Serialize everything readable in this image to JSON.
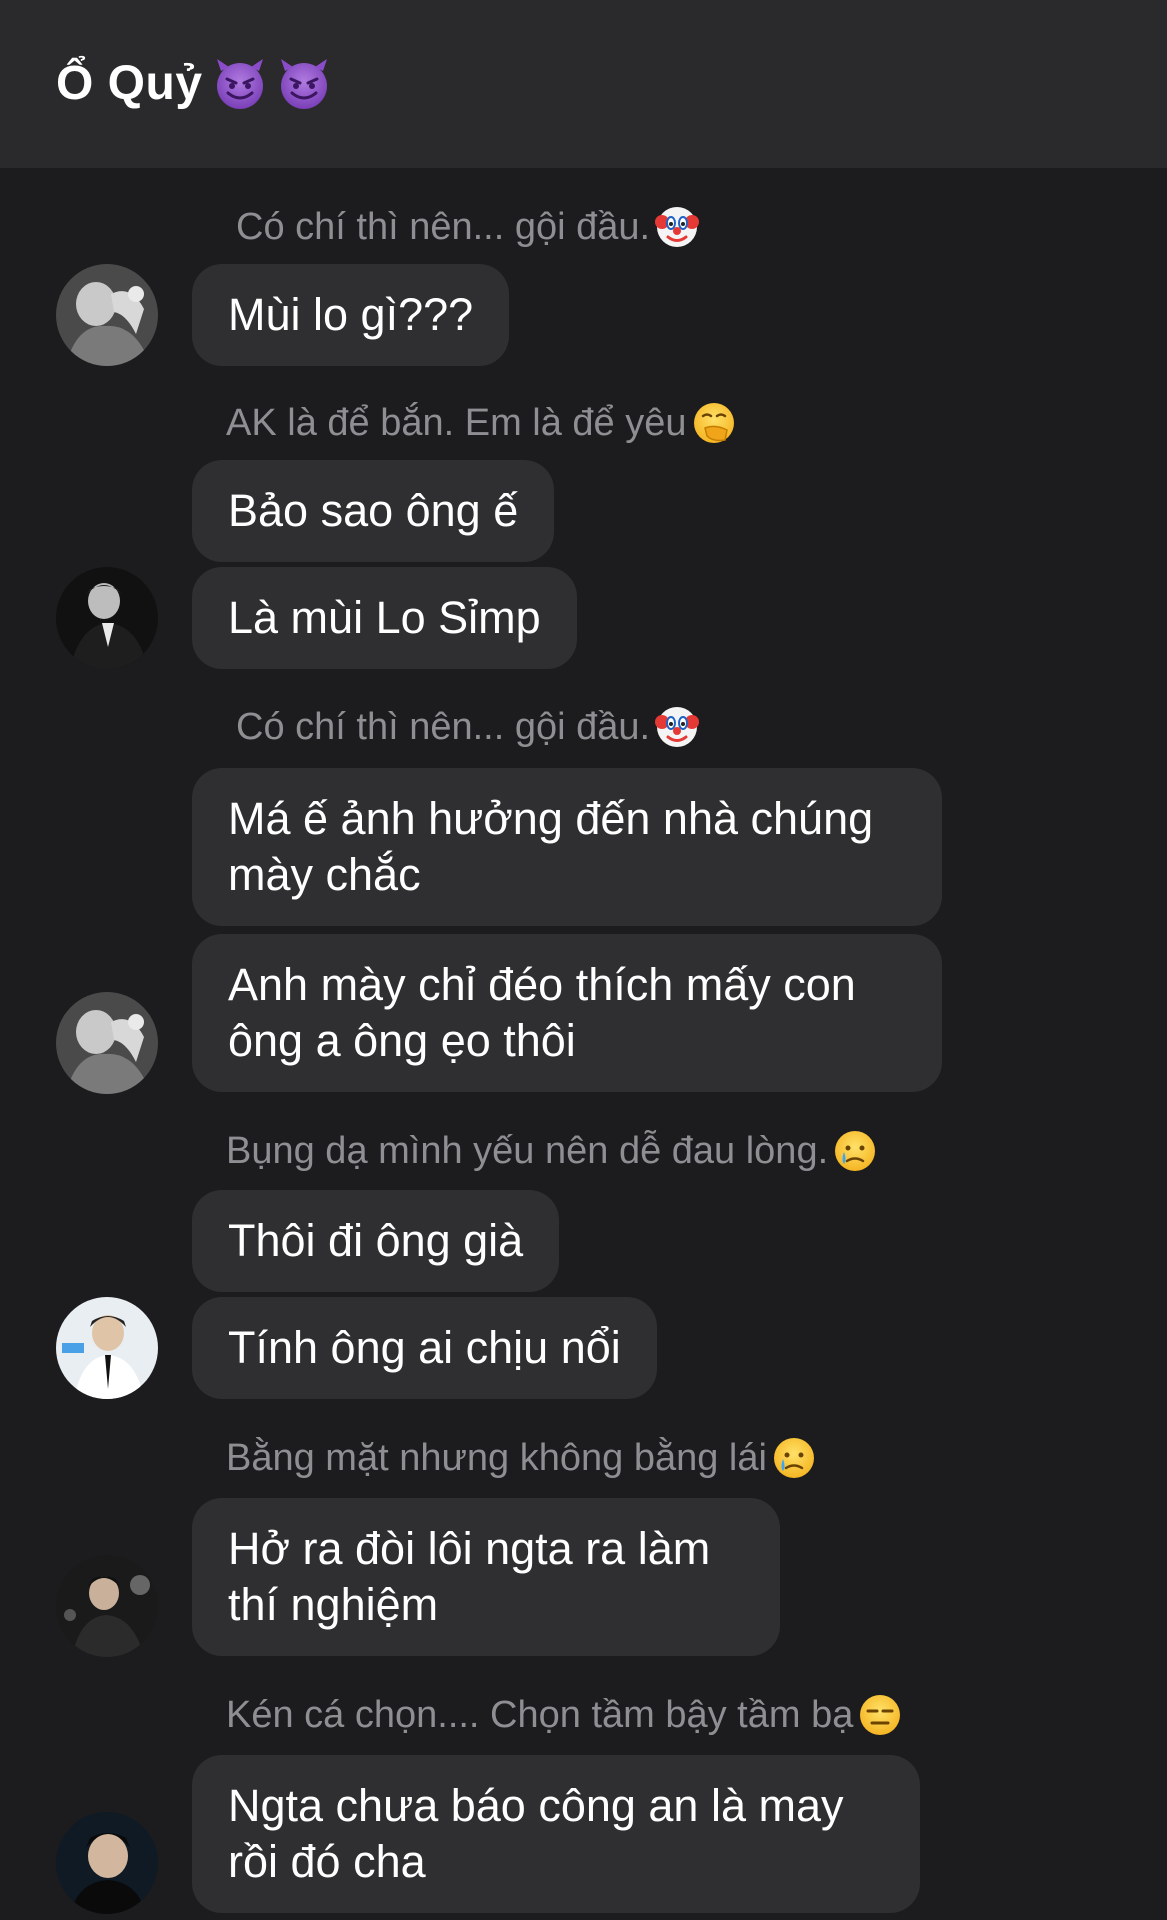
{
  "header": {
    "title": "Ổ Quỷ",
    "title_icons": [
      "devil-emoji",
      "devil-emoji"
    ]
  },
  "messages": [
    {
      "sender": "Có chí thì nên... gội đầu.",
      "sender_icon": "clown-emoji",
      "bubbles": [
        "Mùi lo gì???"
      ]
    },
    {
      "sender": "AK là để bắn. Em là để yêu",
      "sender_icon": "face-with-hand-over-mouth-emoji",
      "bubbles": [
        "Bảo sao ông ế",
        "Là mùi Lo Sỉmp"
      ]
    },
    {
      "sender": "Có chí thì nên... gội đầu.",
      "sender_icon": "clown-emoji",
      "bubbles": [
        "Má ế ảnh hưởng đến nhà chúng mày chắc",
        "Anh mày chỉ đéo thích mấy con ông a ông ẹo thôi"
      ]
    },
    {
      "sender": "Bụng dạ mình yếu nên dễ đau lòng.",
      "sender_icon": "crying-face-emoji",
      "bubbles": [
        "Thôi đi ông già",
        "Tính ông ai chịu nổi"
      ]
    },
    {
      "sender": "Bằng mặt nhưng không bằng lái ",
      "sender_icon": "crying-face-emoji",
      "bubbles": [
        "Hở ra đòi lôi ngta ra làm thí nghiệm"
      ]
    },
    {
      "sender": "Kén cá chọn.... Chọn tầm bậy tầm bạ",
      "sender_icon": "expressionless-face-emoji",
      "bubbles": [
        "Ngta chưa báo công an là may rồi đó cha"
      ]
    }
  ],
  "colors": {
    "background": "#1c1c1e",
    "header_background": "#2a2a2c",
    "bubble_background": "#2f2f31",
    "sender_text": "#8e8e93",
    "message_text": "#ffffff"
  }
}
